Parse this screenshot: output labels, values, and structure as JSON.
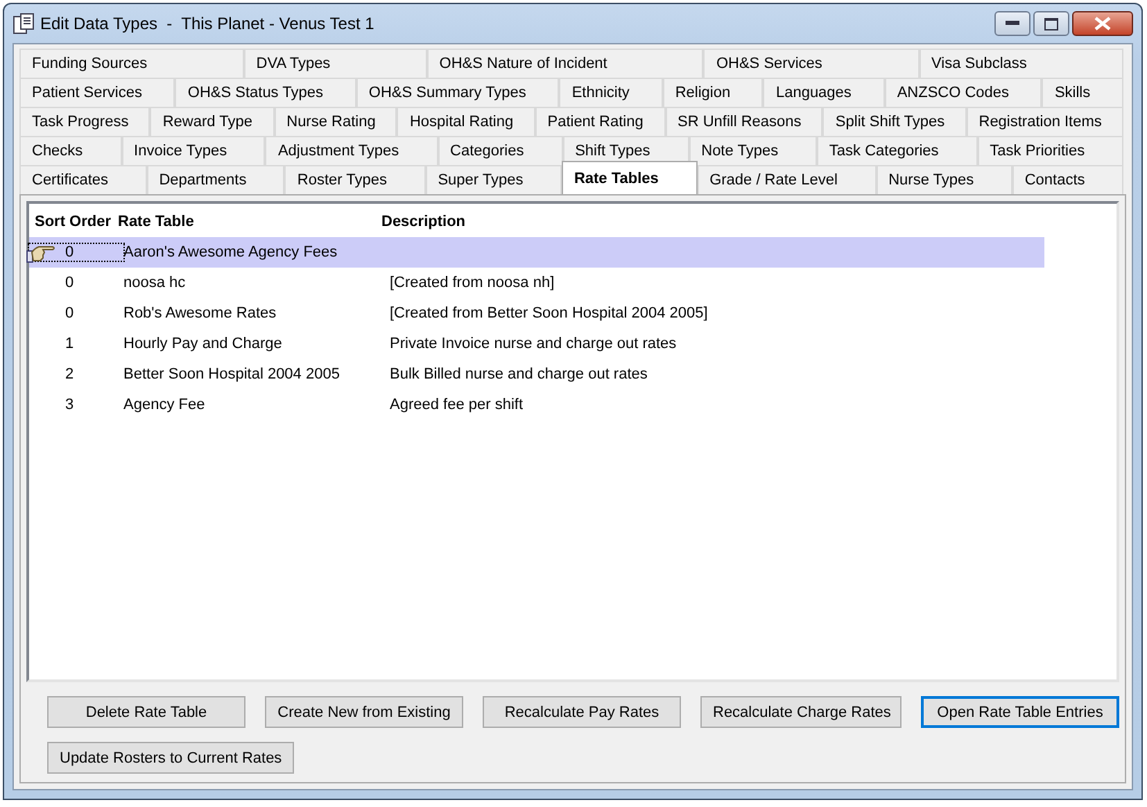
{
  "window": {
    "title": "Edit Data Types  -  This Planet - Venus Test 1"
  },
  "tab_rows": [
    [
      {
        "label": "Funding Sources",
        "selected": false
      },
      {
        "label": "DVA Types",
        "selected": false
      },
      {
        "label": "OH&S Nature of Incident",
        "selected": false
      },
      {
        "label": "OH&S Services",
        "selected": false
      },
      {
        "label": "Visa Subclass",
        "selected": false
      }
    ],
    [
      {
        "label": "Patient Services",
        "selected": false
      },
      {
        "label": "OH&S Status Types",
        "selected": false
      },
      {
        "label": "OH&S Summary Types",
        "selected": false
      },
      {
        "label": "Ethnicity",
        "selected": false
      },
      {
        "label": "Religion",
        "selected": false
      },
      {
        "label": "Languages",
        "selected": false
      },
      {
        "label": "ANZSCO Codes",
        "selected": false
      },
      {
        "label": "Skills",
        "selected": false
      }
    ],
    [
      {
        "label": "Task Progress",
        "selected": false
      },
      {
        "label": "Reward Type",
        "selected": false
      },
      {
        "label": "Nurse Rating",
        "selected": false
      },
      {
        "label": "Hospital Rating",
        "selected": false
      },
      {
        "label": "Patient Rating",
        "selected": false
      },
      {
        "label": "SR Unfill Reasons",
        "selected": false
      },
      {
        "label": "Split Shift Types",
        "selected": false
      },
      {
        "label": "Registration Items",
        "selected": false
      }
    ],
    [
      {
        "label": "Checks",
        "selected": false
      },
      {
        "label": "Invoice Types",
        "selected": false
      },
      {
        "label": "Adjustment Types",
        "selected": false
      },
      {
        "label": "Categories",
        "selected": false
      },
      {
        "label": "Shift Types",
        "selected": false
      },
      {
        "label": "Note Types",
        "selected": false
      },
      {
        "label": "Task Categories",
        "selected": false
      },
      {
        "label": "Task Priorities",
        "selected": false
      }
    ],
    [
      {
        "label": "Certificates",
        "selected": false
      },
      {
        "label": "Departments",
        "selected": false
      },
      {
        "label": "Roster Types",
        "selected": false
      },
      {
        "label": "Super Types",
        "selected": false
      },
      {
        "label": "Rate Tables",
        "selected": true
      },
      {
        "label": "Grade / Rate Level",
        "selected": false
      },
      {
        "label": "Nurse Types",
        "selected": false
      },
      {
        "label": "Contacts",
        "selected": false
      }
    ]
  ],
  "table": {
    "columns": [
      "Sort Order",
      "Rate Table",
      "Description"
    ],
    "rows": [
      {
        "sort_order": "0",
        "rate_table": "Aaron's Awesome Agency Fees",
        "selected": true
      },
      {
        "sort_order": "0",
        "rate_table": "noosa hc",
        "description": "[Created from noosa nh]",
        "selected": false
      },
      {
        "sort_order": "0",
        "rate_table": "Rob's Awesome Rates",
        "description": "[Created from Better Soon Hospital 2004 2005]",
        "selected": false
      },
      {
        "sort_order": "1",
        "rate_table": "Hourly Pay and Charge",
        "description": "Private Invoice nurse and charge out rates",
        "selected": false
      },
      {
        "sort_order": "2",
        "rate_table": "Better Soon Hospital 2004 2005",
        "description": "Bulk Billed nurse and charge out rates",
        "selected": false
      },
      {
        "sort_order": "3",
        "rate_table": "Agency Fee",
        "description": "Agreed fee per shift",
        "selected": false
      }
    ]
  },
  "buttons": [
    [
      {
        "label": "Delete Rate Table",
        "focused": false
      },
      {
        "label": "Create New from Existing",
        "focused": false
      },
      {
        "label": "Recalculate Pay Rates",
        "focused": false
      },
      {
        "label": "Recalculate Charge Rates",
        "focused": false
      },
      {
        "label": "Open Rate Table Entries",
        "focused": true
      }
    ],
    [
      {
        "label": "Update Rosters to Current Rates",
        "focused": false
      }
    ]
  ]
}
